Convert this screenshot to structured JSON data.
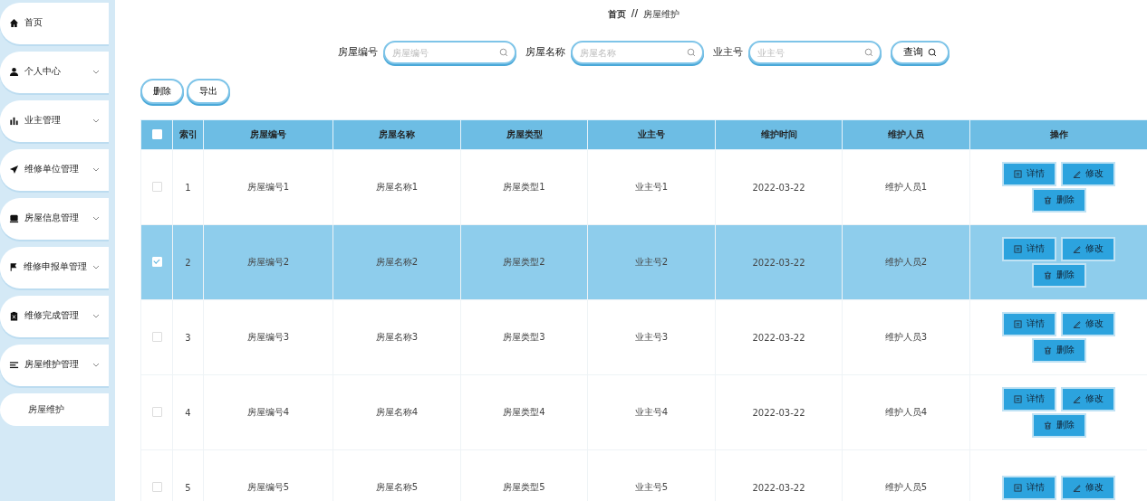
{
  "sidebar": {
    "items": [
      {
        "label": "首页",
        "kind": "link"
      },
      {
        "label": "个人中心",
        "kind": "menu"
      },
      {
        "label": "业主管理",
        "kind": "menu"
      },
      {
        "label": "维修单位管理",
        "kind": "menu"
      },
      {
        "label": "房屋信息管理",
        "kind": "menu"
      },
      {
        "label": "维修申报单管理",
        "kind": "menu"
      },
      {
        "label": "维修完成管理",
        "kind": "menu"
      },
      {
        "label": "房屋维护管理",
        "kind": "menu",
        "children": [
          {
            "label": "房屋维护"
          }
        ]
      }
    ]
  },
  "breadcrumb": {
    "home": "首页",
    "separator": "//",
    "current": "房屋维护"
  },
  "search": {
    "fields": [
      {
        "label": "房屋编号",
        "placeholder": "房屋编号"
      },
      {
        "label": "房屋名称",
        "placeholder": "房屋名称"
      },
      {
        "label": "业主号",
        "placeholder": "业主号"
      }
    ],
    "button": "查询"
  },
  "toolbar": [
    "删除",
    "导出"
  ],
  "table": {
    "header_checked": false,
    "columns": [
      "索引",
      "房屋编号",
      "房屋名称",
      "房屋类型",
      "业主号",
      "维护时间",
      "维护人员",
      "操作"
    ],
    "rows": [
      {
        "selected": false,
        "cells": [
          "1",
          "房屋编号1",
          "房屋名称1",
          "房屋类型1",
          "业主号1",
          "2022-03-22",
          "维护人员1"
        ],
        "actions": [
          "详情",
          "修改",
          "删除"
        ]
      },
      {
        "selected": true,
        "cells": [
          "2",
          "房屋编号2",
          "房屋名称2",
          "房屋类型2",
          "业主号2",
          "2022-03-22",
          "维护人员2"
        ],
        "actions": [
          "详情",
          "修改",
          "删除"
        ]
      },
      {
        "selected": false,
        "cells": [
          "3",
          "房屋编号3",
          "房屋名称3",
          "房屋类型3",
          "业主号3",
          "2022-03-22",
          "维护人员3"
        ],
        "actions": [
          "详情",
          "修改",
          "删除"
        ]
      },
      {
        "selected": false,
        "cells": [
          "4",
          "房屋编号4",
          "房屋名称4",
          "房屋类型4",
          "业主号4",
          "2022-03-22",
          "维护人员4"
        ],
        "actions": [
          "详情",
          "修改",
          "删除"
        ]
      },
      {
        "selected": false,
        "cells": [
          "5",
          "房屋编号5",
          "房屋名称5",
          "房屋类型5",
          "业主号5",
          "2022-03-22",
          "维护人员5"
        ],
        "actions": [
          "详情",
          "修改"
        ]
      }
    ]
  }
}
